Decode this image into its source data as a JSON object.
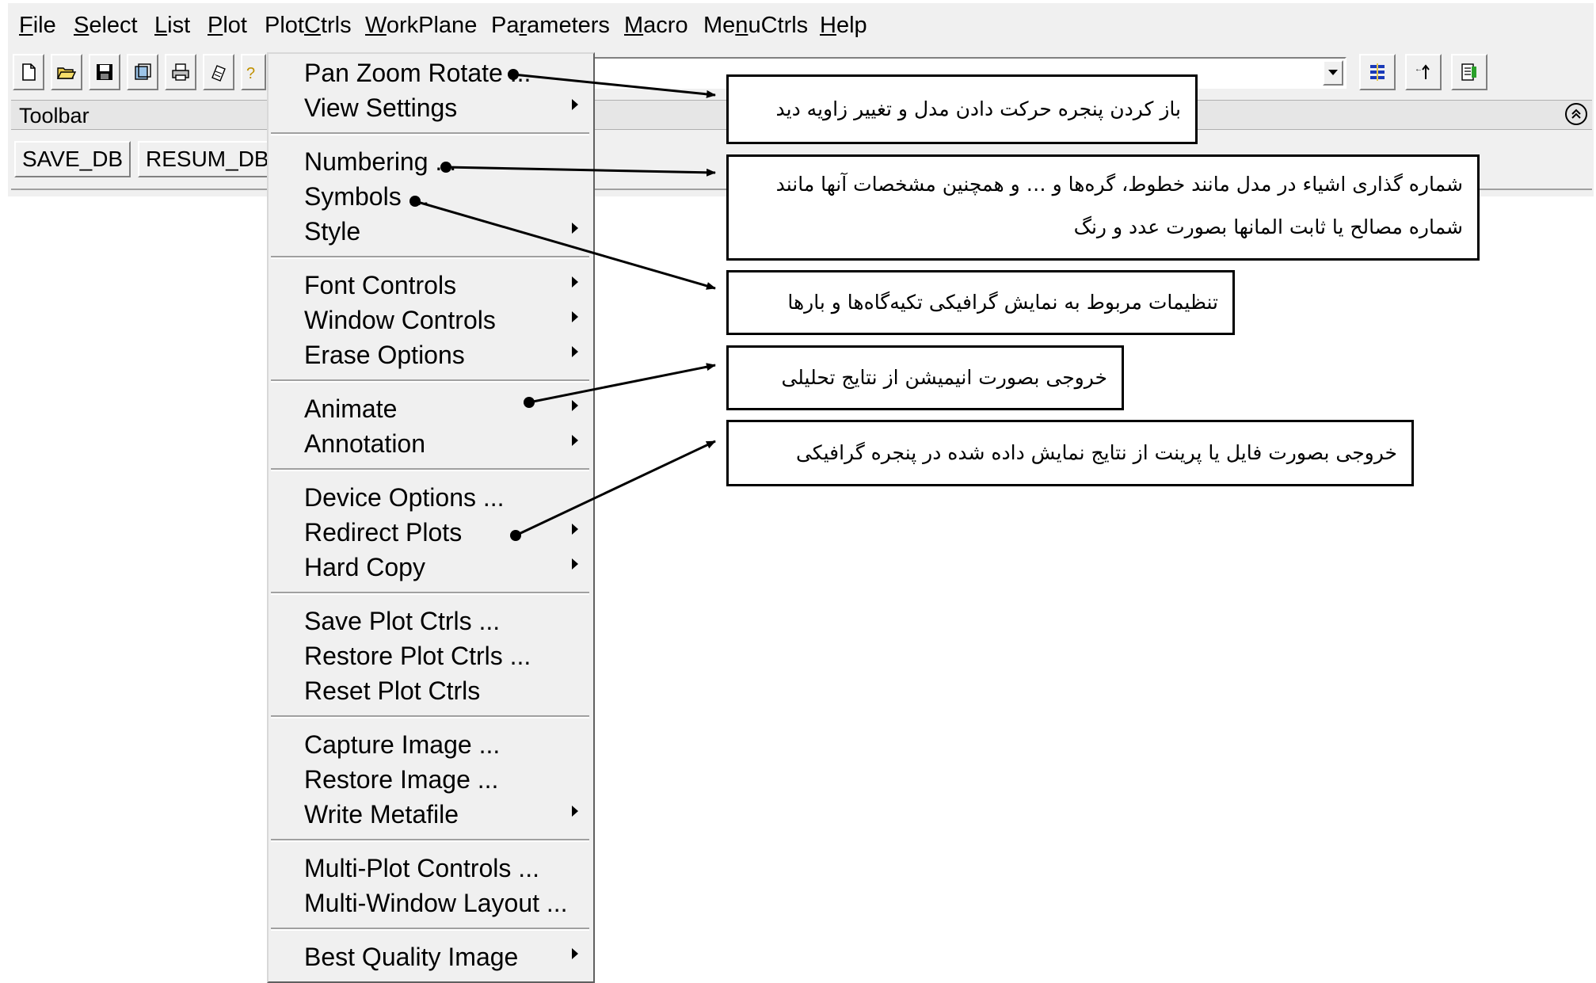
{
  "menubar": {
    "items": [
      {
        "pre": "",
        "u": "F",
        "post": "ile"
      },
      {
        "pre": "",
        "u": "S",
        "post": "elect"
      },
      {
        "pre": "",
        "u": "L",
        "post": "ist"
      },
      {
        "pre": "",
        "u": "P",
        "post": "lot"
      },
      {
        "pre": "Plot",
        "u": "C",
        "post": "trls"
      },
      {
        "pre": "",
        "u": "W",
        "post": "orkPlane"
      },
      {
        "pre": "Pa",
        "u": "r",
        "post": "ameters"
      },
      {
        "pre": "",
        "u": "M",
        "post": "acro"
      },
      {
        "pre": "Me",
        "u": "n",
        "post": "uCtrls"
      },
      {
        "pre": "",
        "u": "H",
        "post": "elp"
      }
    ]
  },
  "toolbar": {
    "icons": [
      "new-file-icon",
      "open-folder-icon",
      "save-icon",
      "resume-icon",
      "print-icon",
      "report-icon",
      "help-icon"
    ],
    "right_icons": [
      "raise-hidden-icon",
      "reset-picking-icon",
      "contact-manager-icon"
    ],
    "title": "Toolbar",
    "buttons": [
      "SAVE_DB",
      "RESUM_DB"
    ]
  },
  "dropdown": {
    "items": [
      {
        "label": "Pan Zoom Rotate ...",
        "submenu": false
      },
      {
        "label": "View Settings",
        "submenu": true
      },
      {
        "label": "Numbering ...",
        "submenu": false
      },
      {
        "label": "Symbols ...",
        "submenu": false
      },
      {
        "label": "Style",
        "submenu": true
      },
      {
        "label": "Font Controls",
        "submenu": true
      },
      {
        "label": "Window Controls",
        "submenu": true
      },
      {
        "label": "Erase Options",
        "submenu": true
      },
      {
        "label": "Animate",
        "submenu": true
      },
      {
        "label": "Annotation",
        "submenu": true
      },
      {
        "label": "Device Options ...",
        "submenu": false
      },
      {
        "label": "Redirect Plots",
        "submenu": true
      },
      {
        "label": "Hard Copy",
        "submenu": true
      },
      {
        "label": "Save Plot Ctrls ...",
        "submenu": false
      },
      {
        "label": "Restore Plot Ctrls ...",
        "submenu": false
      },
      {
        "label": "Reset Plot Ctrls",
        "submenu": false
      },
      {
        "label": "Capture Image ...",
        "submenu": false
      },
      {
        "label": "Restore Image ...",
        "submenu": false
      },
      {
        "label": "Write Metafile",
        "submenu": true
      },
      {
        "label": "Multi-Plot Controls ...",
        "submenu": false
      },
      {
        "label": "Multi-Window Layout ...",
        "submenu": false
      },
      {
        "label": "Best Quality Image",
        "submenu": true
      }
    ]
  },
  "callouts": [
    {
      "text": "باز کردن پنجره حرکت دادن مدل و تغییر زاویه دید"
    },
    {
      "text": "شماره گذاری اشیاء در مدل مانند خطوط، گره‌ها و … و همچنین مشخصات آنها مانند شماره مصالح یا ثابت المانها بصورت عدد و رنگ"
    },
    {
      "text": "تنظیمات مربوط به نمایش گرافیکی تکیه‌گاه‌ها و بارها"
    },
    {
      "text": "خروجی بصورت انیمیشن از نتایج تحلیلی"
    },
    {
      "text": "خروجی بصورت فایل یا پرینت از نتایج نمایش داده شده در پنجره گرافیکی"
    }
  ]
}
